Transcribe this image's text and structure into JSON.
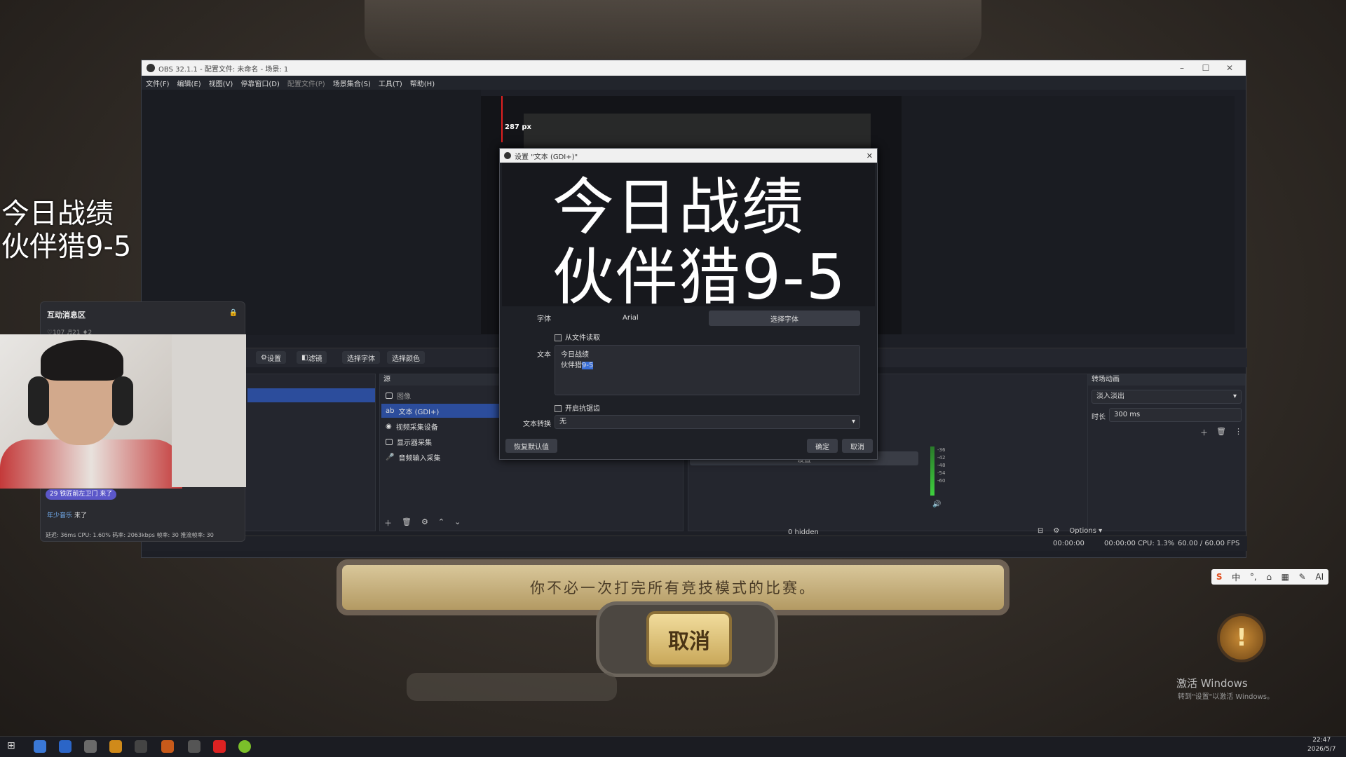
{
  "overlay": {
    "line1": "今日战绩",
    "line2": "伙伴猎9-5"
  },
  "game": {
    "banner": "你不必一次打完所有竞技模式的比赛。",
    "cancel": "取消",
    "quest_icon": "!"
  },
  "obs": {
    "title": "OBS 32.1.1 - 配置文件: 未命名 - 场景: 1",
    "menu": [
      "文件(F)",
      "编辑(E)",
      "视图(V)",
      "停靠窗口(D)",
      "配置文件(P)",
      "场景集合(S)",
      "工具(T)",
      "帮助(H)"
    ],
    "px_label": "287 px",
    "toolbar": [
      "设置",
      "滤镜",
      "选择字体",
      "选择颜色"
    ],
    "sources_title": "源",
    "sources": [
      {
        "label": "图像",
        "icon": "image-icon"
      },
      {
        "label": "文本 (GDI+)",
        "icon": "text-icon"
      },
      {
        "label": "视频采集设备",
        "icon": "camera-icon"
      },
      {
        "label": "显示器采集",
        "icon": "monitor-icon"
      },
      {
        "label": "音频输入采集",
        "icon": "mic-icon"
      }
    ],
    "settings_button": "设置",
    "transition_title": "转场动画",
    "transition_value": "淡入淡出",
    "duration_label": "时长",
    "duration_value": "300 ms",
    "hidden_label": "0 hidden",
    "options_label": "Options",
    "status": {
      "t1": "00:00:00",
      "t2": "00:00:00",
      "cpu": "CPU: 1.3%",
      "fps": "60.00 / 60.00 FPS"
    },
    "meter_ticks": [
      "-36",
      "-42",
      "-48",
      "-54",
      "-60"
    ]
  },
  "dialog": {
    "title": "设置 \"文本 (GDI+)\"",
    "preview_line1": "今日战绩",
    "preview_line2": "伙伴猎9-5",
    "font_label": "字体",
    "font_value": "Arial",
    "choose_font": "选择字体",
    "read_from_file": "从文件读取",
    "text_label": "文本",
    "text_line1": "今日战绩",
    "text_line2_a": "伙伴猎",
    "text_line2_b": "9-5",
    "antialias": "开启抗锯齿",
    "transform_label": "文本转换",
    "transform_value": "无",
    "defaults": "恢复默认值",
    "ok": "确定",
    "cancel": "取消"
  },
  "chat": {
    "title": "互动消息区",
    "counts": "♡107  ♬21  ♦2",
    "msg1": "铁匠前左卫门 来了",
    "msg1_level": "29",
    "msg2_name": "年少音乐",
    "msg2_text": "来了",
    "stats": "延迟: 36ms   CPU: 1.60%   码率: 2063kbps   帧率: 30   推流帧率: 30"
  },
  "system": {
    "activate": "激活 Windows",
    "activate_sub": "转到\"设置\"以激活 Windows。",
    "ime": [
      "S",
      "中",
      "°,",
      "⌂",
      "▦",
      "✎",
      "AI"
    ],
    "time": "22:47",
    "date": "2026/5/7"
  },
  "colors": {
    "accent": "#2c4d9c",
    "obs_bg": "#1d1f26",
    "redline": "#e02020"
  }
}
